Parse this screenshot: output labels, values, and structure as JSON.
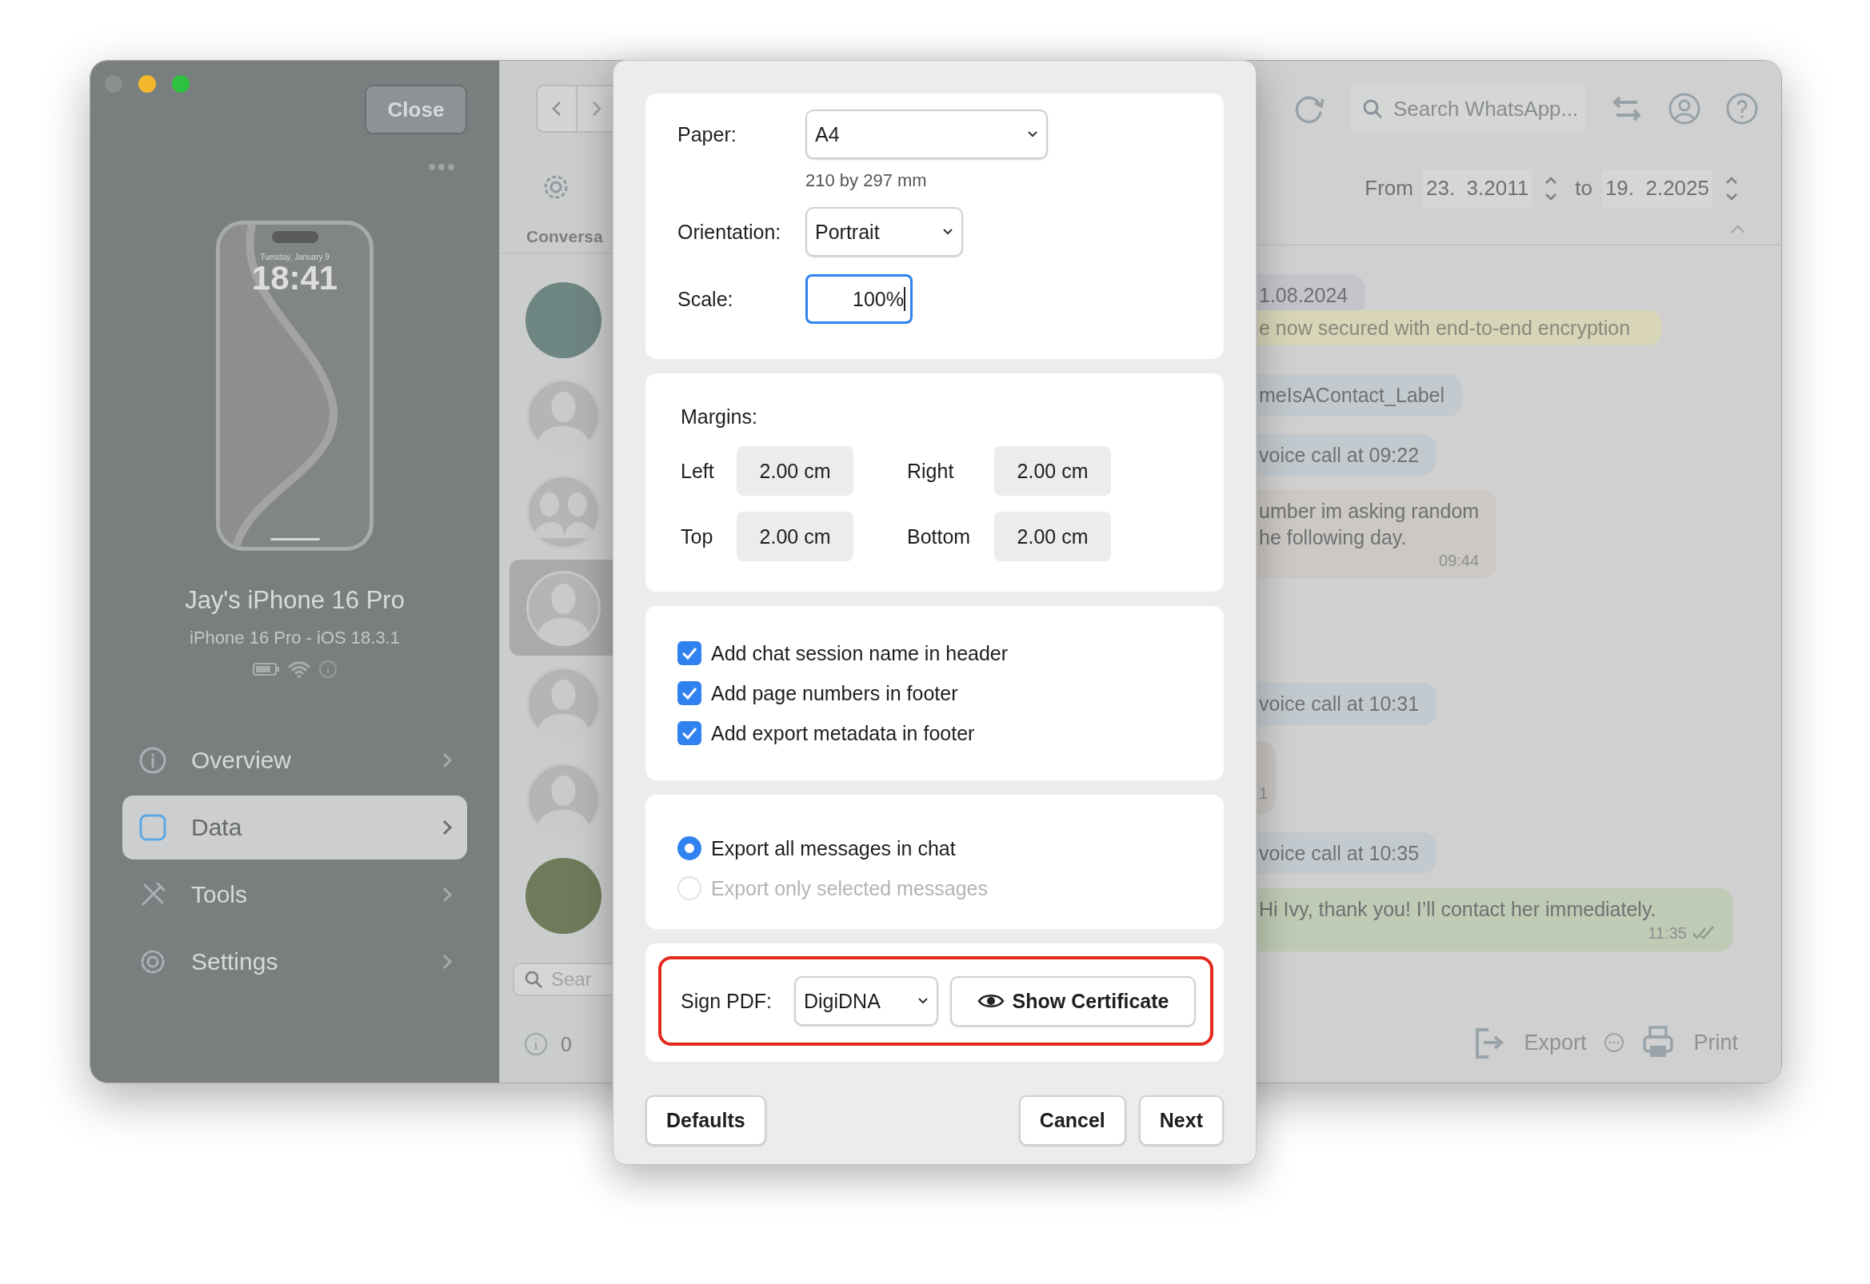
{
  "sidebar": {
    "close_button": "Close",
    "device": {
      "lock_date": "Tuesday, January 9",
      "lock_time": "18:41",
      "name": "Jay's iPhone 16 Pro",
      "model": "iPhone 16 Pro - iOS 18.3.1"
    },
    "items": [
      {
        "label": "Overview",
        "kind": "info",
        "selected": false
      },
      {
        "label": "Data",
        "kind": "data",
        "selected": true
      },
      {
        "label": "Tools",
        "kind": "tools",
        "selected": false
      },
      {
        "label": "Settings",
        "kind": "settings",
        "selected": false
      }
    ]
  },
  "conversations": {
    "column_header": "Conversa",
    "avatars": [
      {
        "kind": "photo",
        "selected": false
      },
      {
        "kind": "person",
        "selected": false
      },
      {
        "kind": "group",
        "selected": false
      },
      {
        "kind": "person",
        "selected": true
      },
      {
        "kind": "person",
        "selected": false
      },
      {
        "kind": "person",
        "selected": false
      },
      {
        "kind": "photo",
        "selected": false
      }
    ],
    "search_placeholder": "Sear",
    "status": "0"
  },
  "chat": {
    "search_placeholder": "Search WhatsApp...",
    "from_label": "From",
    "from_date": "23.  3.2011",
    "to_label": "to",
    "to_date": "19.  2.2025",
    "messages": [
      {
        "kind": "date",
        "text": "1.08.2024"
      },
      {
        "kind": "system",
        "text": "e now secured with end-to-end encryption"
      },
      {
        "kind": "label",
        "text": "meIsAContact_Label"
      },
      {
        "kind": "call",
        "text": "voice call at 09:22"
      },
      {
        "kind": "incoming",
        "text": "umber im asking random\nhe following day.",
        "time": "09:44"
      },
      {
        "kind": "call",
        "text": "voice call at 10:31"
      },
      {
        "kind": "fragment",
        "time": "1"
      },
      {
        "kind": "call",
        "text": "voice call at 10:35"
      },
      {
        "kind": "outgoing",
        "text": "Hi Ivy, thank you! I’ll contact her immediately.",
        "time": "11:35"
      }
    ],
    "actions": [
      {
        "kind": "export",
        "label": "Export"
      },
      {
        "kind": "print",
        "label": "Print"
      }
    ]
  },
  "dialog": {
    "paper_label": "Paper:",
    "paper": "A4",
    "paper_size": "210 by 297 mm",
    "orientation_label": "Orientation:",
    "orientation": "Portrait",
    "scale_label": "Scale:",
    "scale": "100%",
    "margins_label": "Margins:",
    "margins": [
      {
        "label": "Left",
        "value": "2.00 cm"
      },
      {
        "label": "Right",
        "value": "2.00 cm"
      },
      {
        "label": "Top",
        "value": "2.00 cm"
      },
      {
        "label": "Bottom",
        "value": "2.00 cm"
      }
    ],
    "options": [
      {
        "label": "Add chat session name in header",
        "checked": true
      },
      {
        "label": "Add page numbers in footer",
        "checked": true
      },
      {
        "label": "Add export metadata in footer",
        "checked": true
      }
    ],
    "scope": [
      {
        "label": "Export all messages in chat",
        "selected": true,
        "disabled": false
      },
      {
        "label": "Export only selected messages",
        "selected": false,
        "disabled": true
      }
    ],
    "sign": {
      "label": "Sign PDF:",
      "signer": "DigiDNA",
      "button": "Show Certificate",
      "highlighted": true
    },
    "buttons": [
      {
        "label": "Defaults",
        "kind": "left"
      },
      {
        "label": "Cancel",
        "kind": "right"
      },
      {
        "label": "Next",
        "kind": "right"
      }
    ]
  }
}
